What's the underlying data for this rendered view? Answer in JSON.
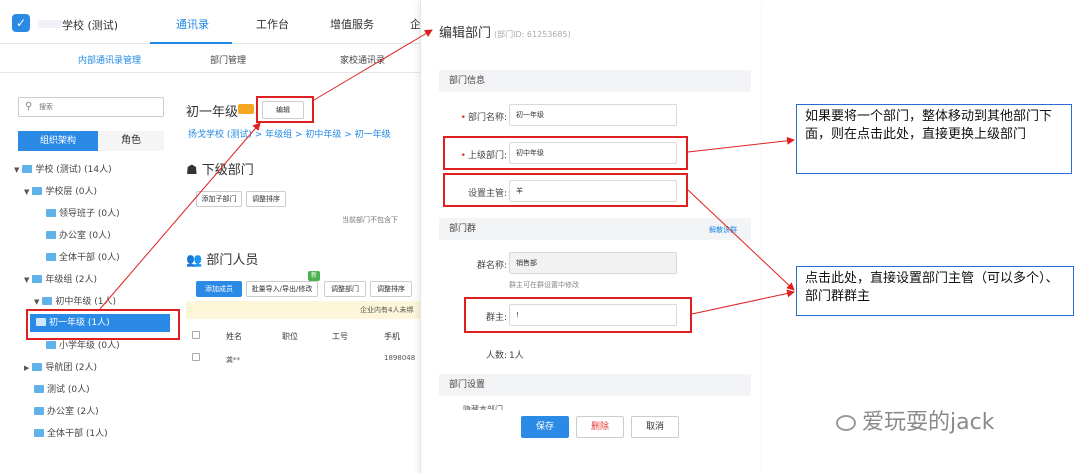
{
  "app": {
    "school_name": "学校 (测试)",
    "nav": [
      "通讯录",
      "工作台",
      "增值服务",
      "企"
    ],
    "subnav": [
      "内部通讯录管理",
      "部门管理",
      "家校通讯录"
    ],
    "search_placeholder": "搜索",
    "tabs": {
      "org": "组织架构",
      "role": "角色"
    },
    "tree": [
      {
        "label": "学校 (测试) (14人)",
        "arrow": "▼"
      },
      {
        "label": "学校层 (0人)",
        "arrow": "▼"
      },
      {
        "label": "领导班子 (0人)",
        "arrow": ""
      },
      {
        "label": "办公室 (0人)",
        "arrow": ""
      },
      {
        "label": "全体干部 (0人)",
        "arrow": ""
      },
      {
        "label": "年级组 (2人)",
        "arrow": "▼"
      },
      {
        "label": "初中年级 (1人)",
        "arrow": "▼"
      },
      {
        "label": "初一年级 (1人)",
        "arrow": ""
      },
      {
        "label": "小学年级 (0人)",
        "arrow": ""
      },
      {
        "label": "导航团 (2人)",
        "arrow": "▶"
      },
      {
        "label": "测试 (0人)",
        "arrow": ""
      },
      {
        "label": "办公室 (2人)",
        "arrow": ""
      },
      {
        "label": "全体干部 (1人)",
        "arrow": ""
      }
    ],
    "main": {
      "dept_title": "初一年级",
      "edit_label": "编辑",
      "breadcrumb": "扬戈学校 (测试) > 年级组 > 初中年级 > 初一年级",
      "sub_dept_heading": "下级部门",
      "add_sub_dept": "添加子部门",
      "adjust_order": "调整排序",
      "sub_note": "当前部门不包含下",
      "members_heading": "部门人员",
      "add_member": "添加成员",
      "batch_import": "批量导入/导出/修改",
      "badge_new": "新",
      "adjust_dept": "调整部门",
      "adjust_order2": "调整排序",
      "member_note": "企业内有4人未绑",
      "columns": [
        "姓名",
        "职位",
        "工号",
        "手机"
      ],
      "row_name": "龚**",
      "row_phone": "1898048"
    }
  },
  "panel": {
    "title": "编辑部门",
    "dept_id": "(部门ID: 61253685)",
    "section_info": "部门信息",
    "name_label": "部门名称:",
    "name_value": "初一年级",
    "parent_label": "上级部门:",
    "parent_value": "初中年级",
    "manager_label": "设置主管:",
    "manager_value": "羊",
    "section_group": "部门群",
    "disband_group": "解散该群",
    "group_name_label": "群名称:",
    "group_name_value": "销售部",
    "group_hint": "群主可在群设置中修改",
    "group_owner_label": "群主:",
    "group_owner_value": "!",
    "group_count_label": "人数:",
    "group_count_value": "1人",
    "section_settings": "部门设置",
    "settings_partial": "隐藏本部门",
    "save": "保存",
    "delete": "删除",
    "cancel": "取消"
  },
  "annotations": {
    "callout_parent": "如果要将一个部门，整体移动到其他部门下面，则在点击此处，直接更换上级部门",
    "callout_manager": "点击此处，直接设置部门主管（可以多个）、部门群群主",
    "watermark": "爱玩耍的jack",
    "arrow_color": "#e02020"
  }
}
